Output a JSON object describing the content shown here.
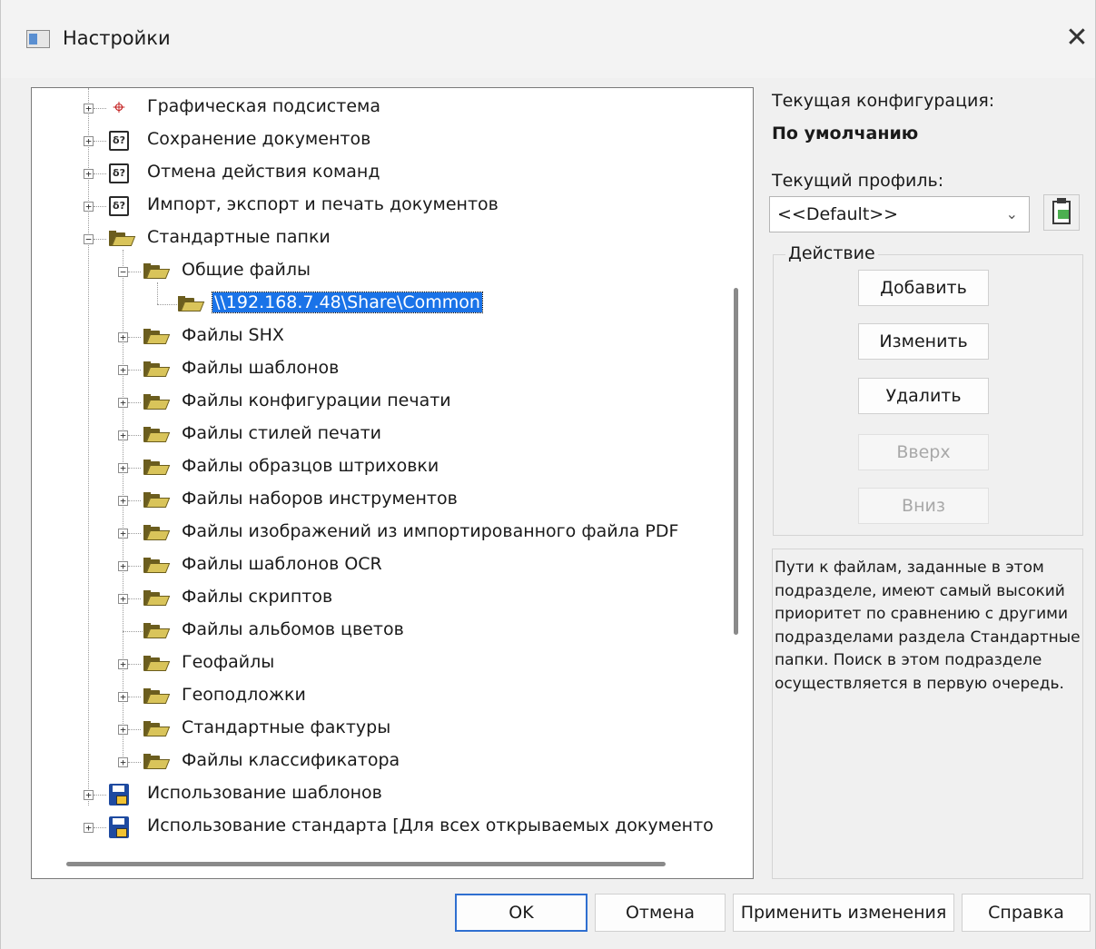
{
  "window": {
    "title": "Настройки",
    "close_glyph": "✕"
  },
  "tree": {
    "items": [
      {
        "label": "Графическая подсистема",
        "icon": "graphics-cursor-icon"
      },
      {
        "label": "Сохранение документов",
        "icon": "config-icon"
      },
      {
        "label": "Отмена действия команд",
        "icon": "config-icon"
      },
      {
        "label": "Импорт, экспорт и печать документов",
        "icon": "config-icon"
      },
      {
        "label": "Стандартные папки",
        "icon": "folder-icon"
      },
      {
        "label": "Общие файлы",
        "icon": "folder-icon"
      },
      {
        "label": "\\\\192.168.7.48\\Share\\Common",
        "icon": "folder-icon",
        "selected": true
      },
      {
        "label": "Файлы SHX",
        "icon": "folder-icon"
      },
      {
        "label": "Файлы шаблонов",
        "icon": "folder-icon"
      },
      {
        "label": "Файлы конфигурации печати",
        "icon": "folder-icon"
      },
      {
        "label": "Файлы стилей печати",
        "icon": "folder-icon"
      },
      {
        "label": "Файлы образцов штриховки",
        "icon": "folder-icon"
      },
      {
        "label": "Файлы наборов инструментов",
        "icon": "folder-icon"
      },
      {
        "label": "Файлы изображений из импортированного файла PDF",
        "icon": "folder-icon"
      },
      {
        "label": "Файлы шаблонов OCR",
        "icon": "folder-icon"
      },
      {
        "label": "Файлы скриптов",
        "icon": "folder-icon"
      },
      {
        "label": "Файлы альбомов цветов",
        "icon": "folder-icon"
      },
      {
        "label": "Геофайлы",
        "icon": "folder-icon"
      },
      {
        "label": "Геоподложки",
        "icon": "folder-icon"
      },
      {
        "label": "Стандартные фактуры",
        "icon": "folder-icon"
      },
      {
        "label": "Файлы классификатора",
        "icon": "folder-icon"
      },
      {
        "label": "Использование шаблонов",
        "icon": "template-disk-icon"
      },
      {
        "label": "Использование стандарта [Для всех открываемых документо",
        "icon": "template-disk-icon"
      }
    ]
  },
  "config": {
    "caption": "Текущая конфигурация:",
    "value": "По умолчанию",
    "profile_caption": "Текущий профиль:",
    "profile_value": "<<Default>>"
  },
  "actions": {
    "group_label": "Действие",
    "add": "Добавить",
    "edit": "Изменить",
    "delete": "Удалить",
    "up": "Вверх",
    "down": "Вниз"
  },
  "description": "Пути к файлам, заданные в этом подразделе, имеют самый высокий приоритет по сравнению с другими подразделами раздела Стандартные папки. Поиск в этом подразделе осуществляется в первую очередь.",
  "footer": {
    "ok": "OK",
    "cancel": "Отмена",
    "apply": "Применить изменения",
    "help": "Справка"
  }
}
